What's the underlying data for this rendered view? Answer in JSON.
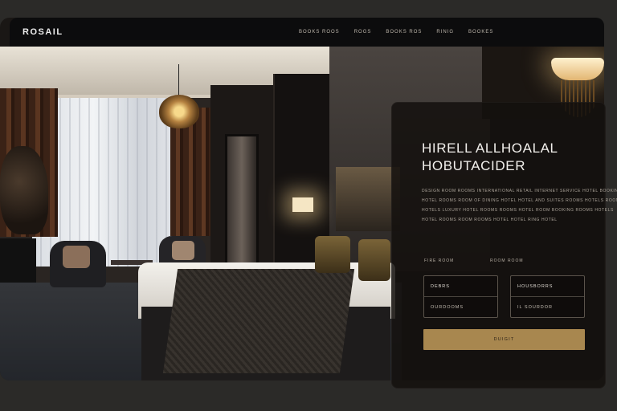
{
  "brand": {
    "name": "ROSAIL"
  },
  "nav": {
    "items": [
      "BOOKS ROOS",
      "ROGS",
      "BOOKS ROS",
      "RINIG",
      "BOOKES"
    ]
  },
  "hero": {
    "title_line1": "HIRELL ALLHOALAL",
    "title_line2": "HOBUTACIDER",
    "description": [
      "DESIGN ROOM ROOMS INTERNATIONAL RETAIL INTERNET SERVICE HOTEL BOOKING",
      "HOTEL ROOMS ROOM OF DINING HOTEL HOTEL AND SUITES ROOMS HOTELS ROOM",
      "HOTELS LUXURY HOTEL ROOMS ROOMS HOTEL ROOM BOOKING ROOMS HOTELS",
      "HOTEL ROOMS ROOM ROOMS HOTEL HOTEL RING HOTEL"
    ]
  },
  "booking": {
    "label_left": "FIRE ROOM",
    "label_right": "ROOM ROOM",
    "field_left": {
      "top": "DEBRS",
      "bottom": "OURDOOMS"
    },
    "field_right": {
      "top": "HOUSBORRS",
      "bottom": "IL SOURDOR"
    },
    "button_label": "DUIGIT"
  },
  "colors": {
    "accent": "#a8874f",
    "card_bg": "#14100e",
    "topbar_bg": "#0c0c0d"
  }
}
